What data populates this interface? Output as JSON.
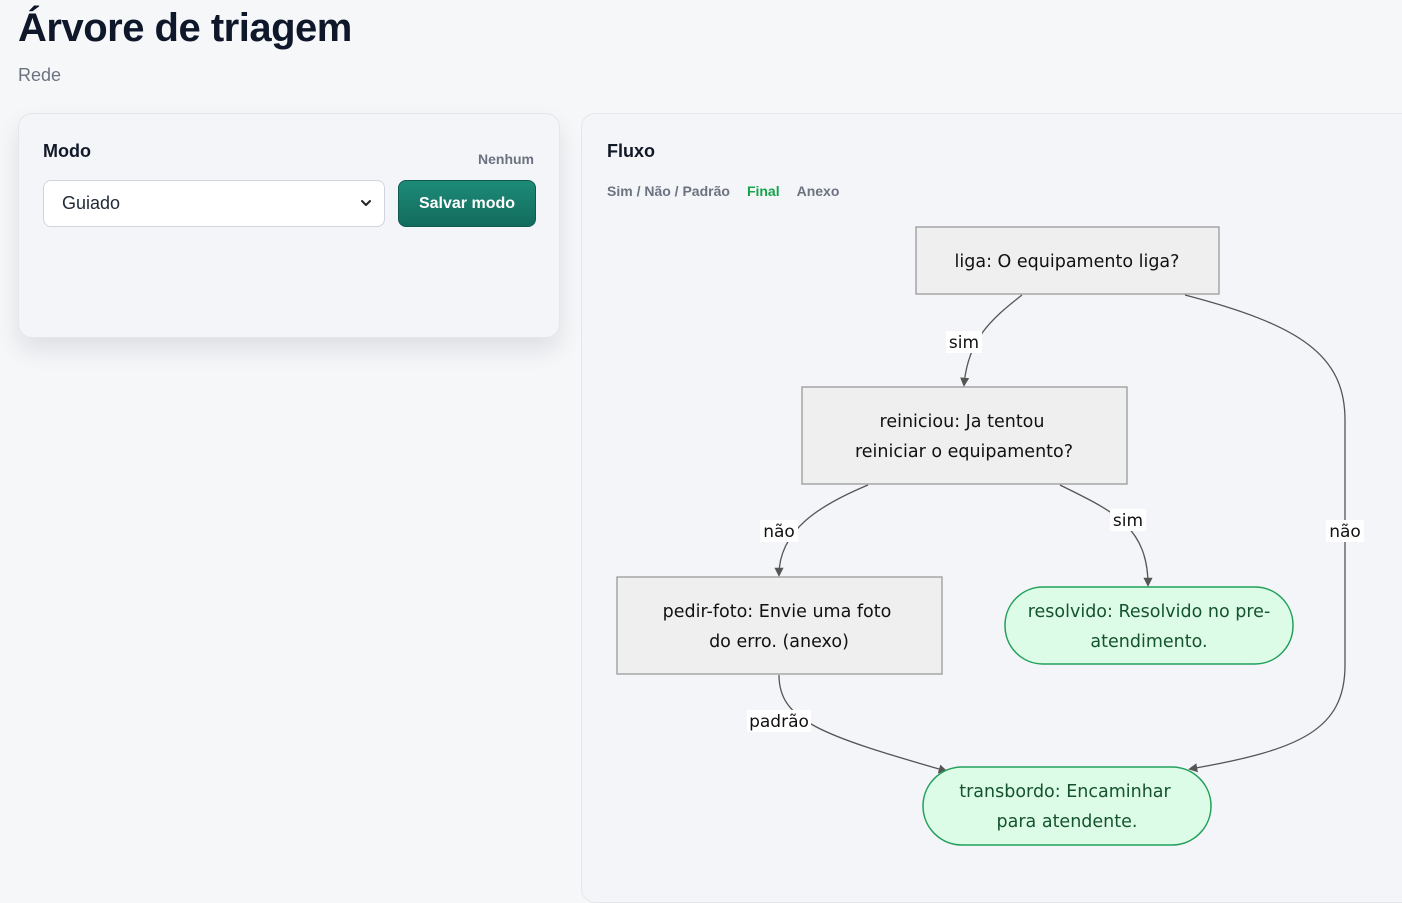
{
  "header": {
    "title": "Árvore de triagem",
    "subtitle": "Rede"
  },
  "mode_panel": {
    "title": "Modo",
    "status": "Nenhum",
    "select_value": "Guiado",
    "save_label": "Salvar modo"
  },
  "flow_panel": {
    "title": "Fluxo",
    "legend": {
      "decision": "Sim / Não / Padrão",
      "final": "Final",
      "attachment": "Anexo"
    }
  },
  "diagram": {
    "nodes": {
      "liga": {
        "lines": [
          "liga: O equipamento liga?"
        ],
        "kind": "question"
      },
      "reiniciou": {
        "lines": [
          "reiniciou: Ja tentou",
          "reiniciar o equipamento?"
        ],
        "kind": "question"
      },
      "pedir_foto": {
        "lines": [
          "pedir-foto: Envie uma foto",
          "do erro. (anexo)"
        ],
        "kind": "question"
      },
      "resolvido": {
        "lines": [
          "resolvido: Resolvido no pre-",
          "atendimento."
        ],
        "kind": "final"
      },
      "transbordo": {
        "lines": [
          "transbordo: Encaminhar",
          "para atendente."
        ],
        "kind": "final"
      }
    },
    "edges": [
      {
        "from": "liga",
        "to": "reiniciou",
        "label": "sim"
      },
      {
        "from": "liga",
        "to": "transbordo",
        "label": "não"
      },
      {
        "from": "reiniciou",
        "to": "pedir_foto",
        "label": "não"
      },
      {
        "from": "reiniciou",
        "to": "resolvido",
        "label": "sim"
      },
      {
        "from": "pedir_foto",
        "to": "transbordo",
        "label": "padrão"
      }
    ]
  },
  "colors": {
    "accent": "#1a7f6e",
    "final_fill": "#dcfce7",
    "final_stroke": "#22a05a",
    "node_fill": "#efefef",
    "node_stroke": "#999999",
    "edge": "#555555"
  }
}
